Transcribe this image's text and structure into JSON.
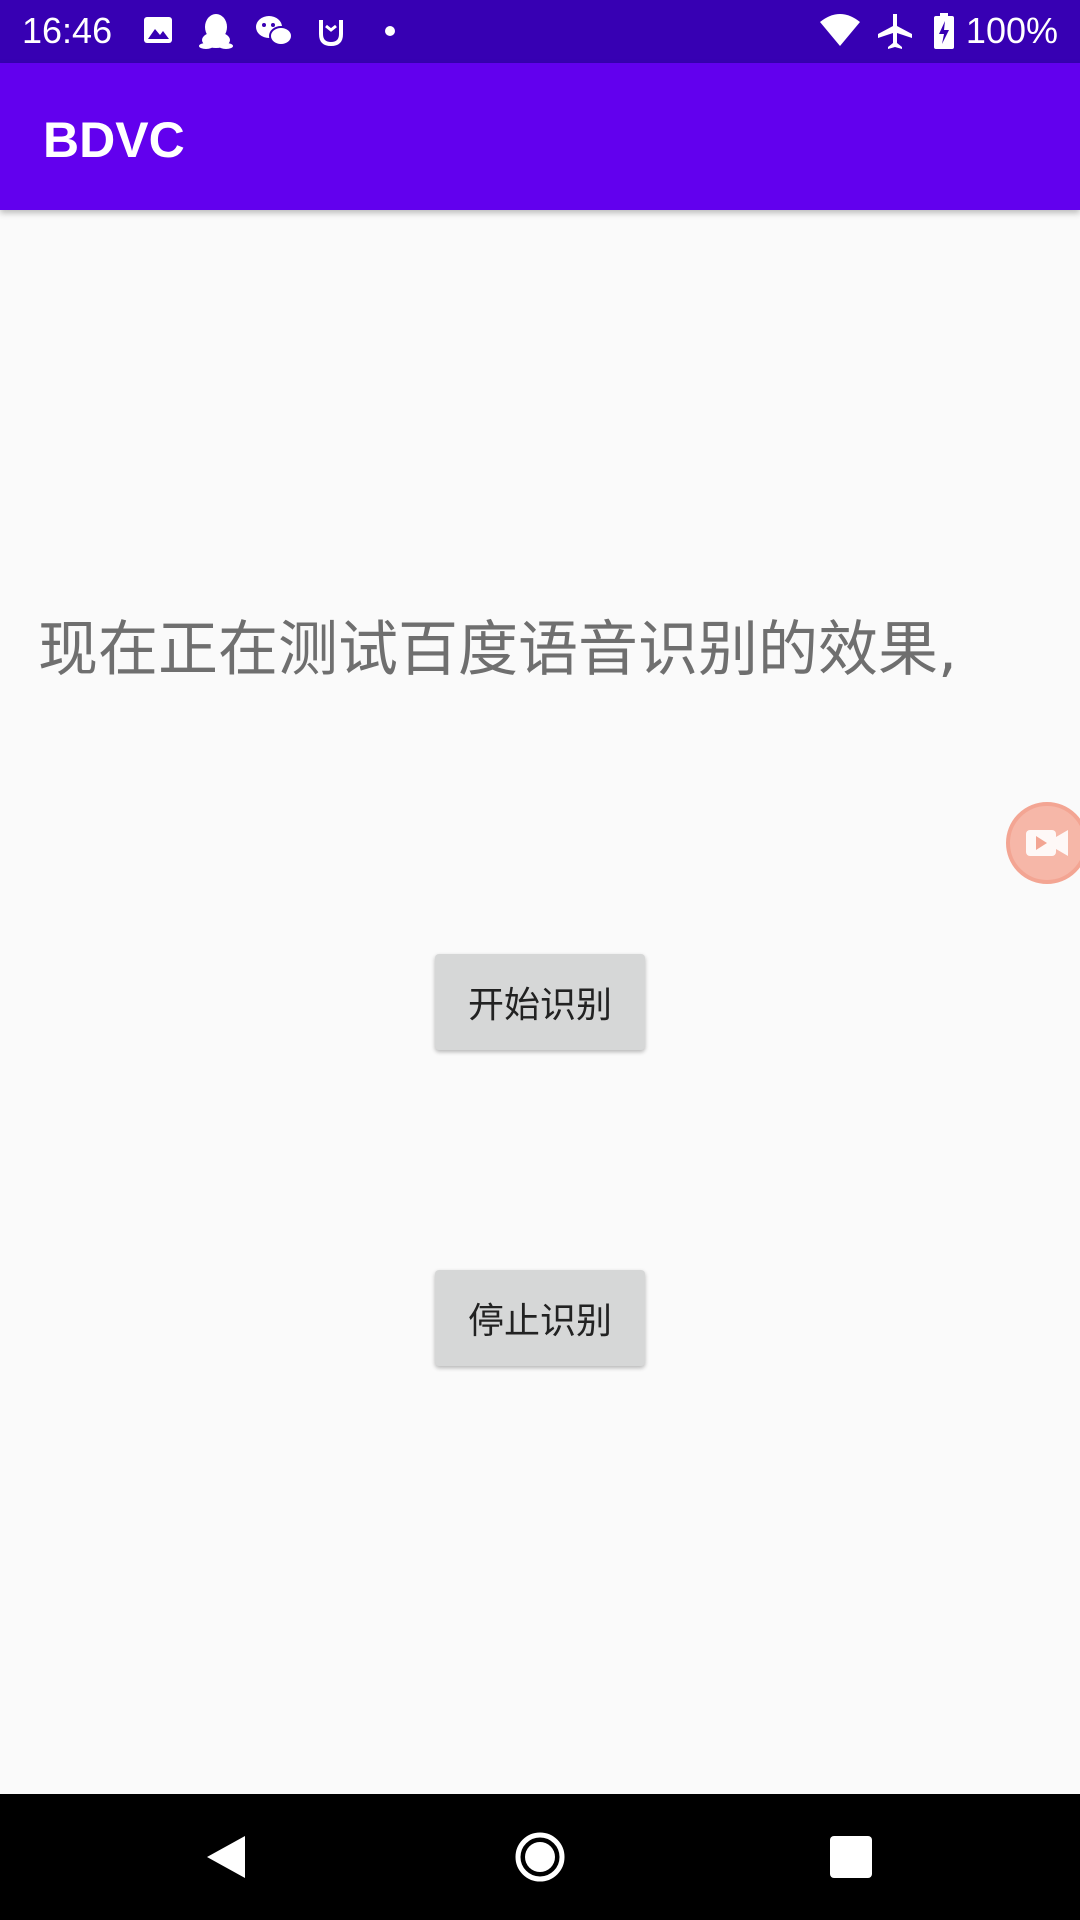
{
  "status_bar": {
    "time": "16:46",
    "battery": "100%",
    "icons": [
      "image-icon",
      "qq-icon",
      "wechat-icon",
      "mi-icon",
      "dot-icon",
      "wifi-icon",
      "airplane-icon",
      "battery-icon"
    ],
    "background": "#3700b3"
  },
  "app_bar": {
    "title": "BDVC",
    "background": "#6200ee"
  },
  "main": {
    "recognized_text": "现在正在测试百度语音识别的效果,",
    "start_button_label": "开始识别",
    "stop_button_label": "停止识别"
  },
  "floating_bubble": {
    "icon": "video-camera-icon",
    "color": "#f6b7a8"
  },
  "nav_bar": {
    "icons": [
      "back-icon",
      "home-icon",
      "recents-icon"
    ]
  }
}
